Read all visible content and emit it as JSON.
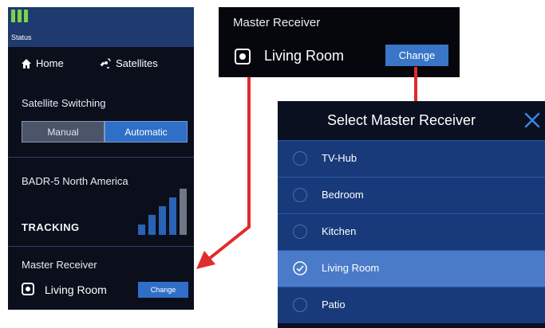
{
  "status": {
    "label": "Status"
  },
  "nav": {
    "home": "Home",
    "satellites": "Satellites"
  },
  "switching": {
    "title": "Satellite Switching",
    "options": [
      "Manual",
      "Automatic"
    ],
    "selected": "Automatic"
  },
  "satellite": {
    "region": "BADR-5 North America",
    "state": "TRACKING",
    "signal_bars_lit": 4,
    "signal_bars_total": 5
  },
  "master_receiver": {
    "title": "Master Receiver",
    "room": "Living Room",
    "change_label": "Change"
  },
  "callout": {
    "title": "Master Receiver",
    "room": "Living Room",
    "change_label": "Change"
  },
  "dialog": {
    "title": "Select Master Receiver",
    "options": [
      {
        "label": "TV-Hub",
        "selected": false
      },
      {
        "label": "Bedroom",
        "selected": false
      },
      {
        "label": "Kitchen",
        "selected": false
      },
      {
        "label": "Living Room",
        "selected": true
      },
      {
        "label": "Patio",
        "selected": false
      }
    ]
  },
  "colors": {
    "accent": "#2f6fc7",
    "signal_green": "#7bd34a",
    "arrow_red": "#e02b2b",
    "selected_row": "#4a7bc8"
  }
}
